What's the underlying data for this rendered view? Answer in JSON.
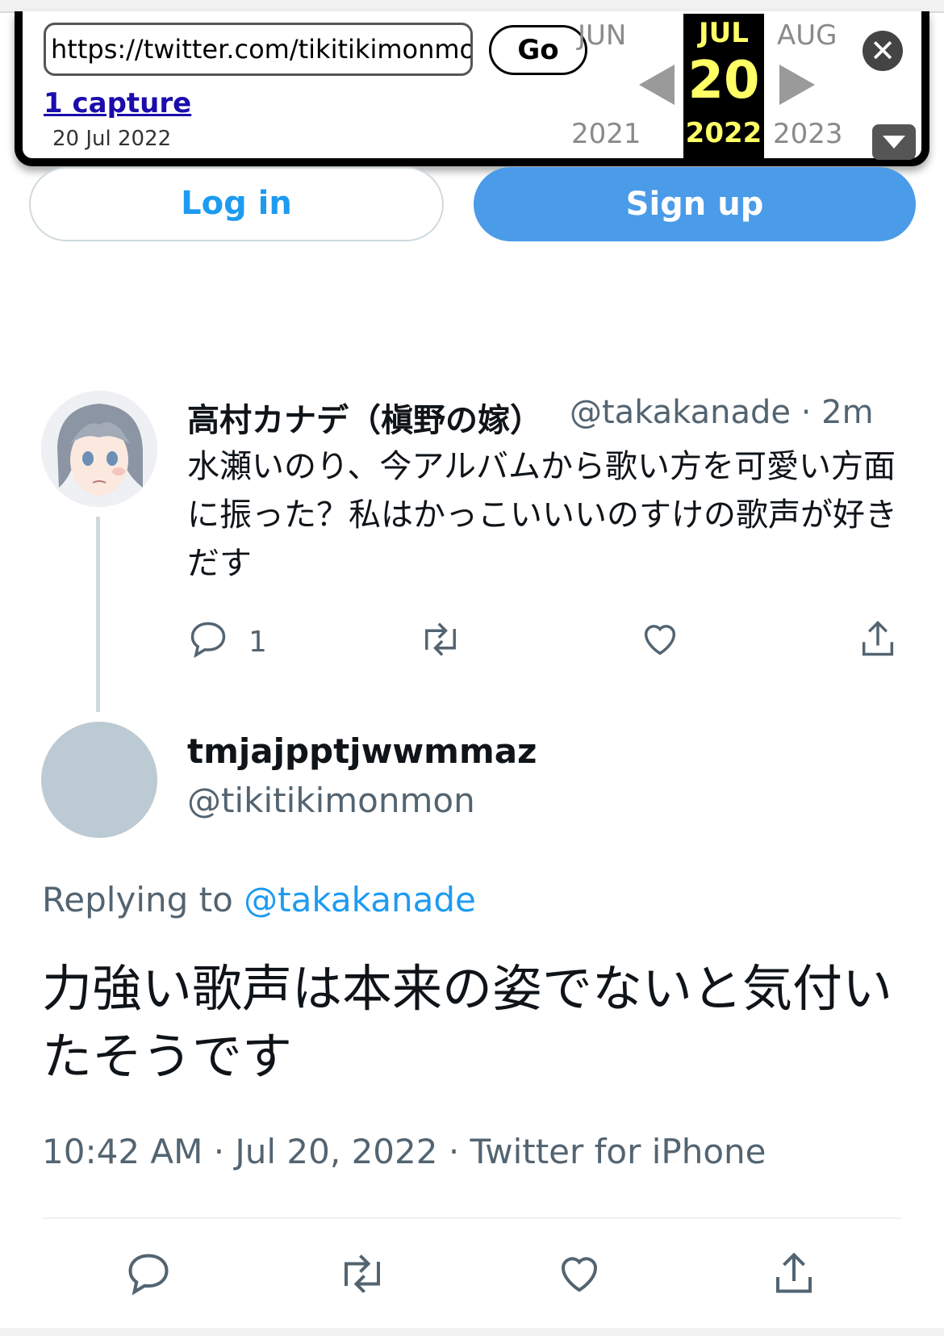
{
  "wayback": {
    "url": "https://twitter.com/tikitikimonmon/",
    "go_label": "Go",
    "captures_label": "1 capture",
    "capture_date": "20 Jul 2022",
    "prev_month": "JUN",
    "current_month": "JUL",
    "next_month": "AUG",
    "current_day": "20",
    "prev_year": "2021",
    "current_year": "2022",
    "next_year": "2023",
    "close_icon": "close-icon",
    "dropdown_icon": "chevron-down-icon"
  },
  "auth": {
    "login_label": "Log in",
    "signup_label": "Sign up"
  },
  "tweet_parent": {
    "display_name": "高村カナデ（槇野の嫁）",
    "handle_time": "@takakanade · 2m",
    "text": "水瀬いのり、今アルバムから歌い方を可愛い方面に振った？私はかっこいいいのすけの歌声が好きだす",
    "reply_count": "1",
    "icons": [
      "reply-icon",
      "retweet-icon",
      "like-icon",
      "share-icon"
    ]
  },
  "tweet_main": {
    "display_name": "tmjajpptjwwmmaz",
    "handle": "@tikitikimonmon",
    "replying_prefix": "Replying to ",
    "replying_handle": "@takakanade",
    "text": "力強い歌声は本来の姿でないと気付いたそうです",
    "meta": "10:42 AM · Jul 20, 2022 · Twitter for iPhone",
    "icons": [
      "reply-icon",
      "retweet-icon",
      "like-icon",
      "share-icon"
    ]
  },
  "colors": {
    "accent": "#1d9bf0",
    "signup_bg": "#4a9be8",
    "secondary_text": "#536471",
    "wayback_highlight": "#ffff66"
  }
}
